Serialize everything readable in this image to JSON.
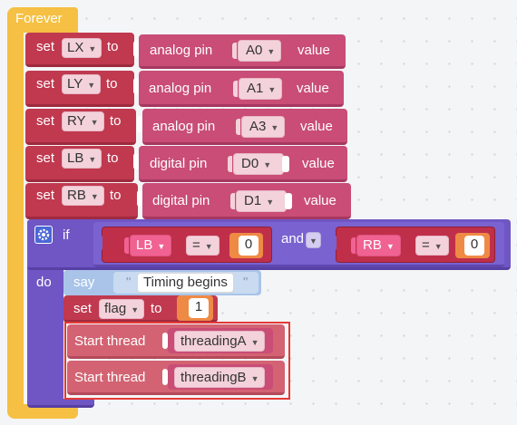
{
  "forever": {
    "label": "Forever"
  },
  "set_blocks": [
    {
      "set": "set",
      "var": "LX",
      "to": "to",
      "source": "analog pin",
      "pin": "A0",
      "value": "value"
    },
    {
      "set": "set",
      "var": "LY",
      "to": "to",
      "source": "analog pin",
      "pin": "A1",
      "value": "value"
    },
    {
      "set": "set",
      "var": "RY",
      "to": "to",
      "source": "analog pin",
      "pin": "A3",
      "value": "value"
    },
    {
      "set": "set",
      "var": "LB",
      "to": "to",
      "source": "digital pin",
      "pin": "D0",
      "value": "value"
    },
    {
      "set": "set",
      "var": "RB",
      "to": "to",
      "source": "digital pin",
      "pin": "D1",
      "value": "value"
    }
  ],
  "if_block": {
    "if_label": "if",
    "do_label": "do",
    "cond1": {
      "var": "LB",
      "op": "=",
      "num": "0"
    },
    "logic": "and",
    "cond2": {
      "var": "RB",
      "op": "=",
      "num": "0"
    }
  },
  "say_block": {
    "label": "say",
    "quote_open": "\"",
    "text": "Timing begins",
    "quote_close": "\""
  },
  "set_flag": {
    "set": "set",
    "var": "flag",
    "to": "to",
    "num": "1"
  },
  "threads": [
    {
      "label": "Start thread",
      "name": "threadingA"
    },
    {
      "label": "Start thread",
      "name": "threadingB"
    }
  ],
  "colors": {
    "forever": "#f5c043",
    "set_block": "#c0394f",
    "sensor_block": "#c94d76",
    "if_block": "#6f56c4",
    "compare_block": "#c02f4a",
    "logic_block": "#7a62d0",
    "say_block": "#a9c4e8",
    "thread_block": "#d36372",
    "highlight": "#e53935"
  },
  "icons": [
    "gear-icon",
    "chevron-down-icon"
  ]
}
